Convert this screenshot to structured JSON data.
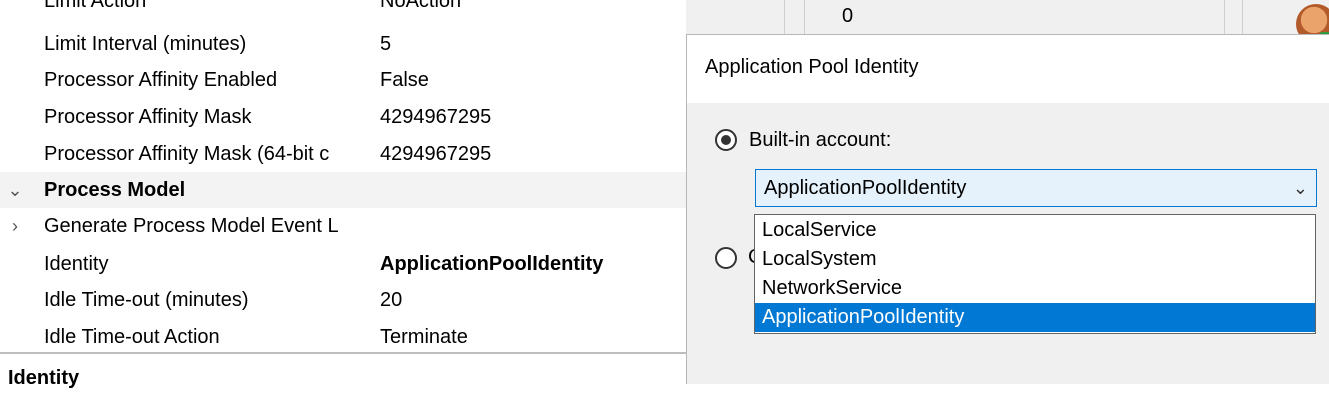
{
  "properties": {
    "rows": [
      {
        "name": "Limit Action",
        "value": "NoAction"
      },
      {
        "name": "Limit Interval (minutes)",
        "value": "5"
      },
      {
        "name": "Processor Affinity Enabled",
        "value": "False"
      },
      {
        "name": "Processor Affinity Mask",
        "value": "4294967295"
      },
      {
        "name": "Processor Affinity Mask (64-bit c",
        "value": "4294967295"
      },
      {
        "name": "Process Model",
        "value": ""
      },
      {
        "name": "Generate Process Model Event L",
        "value": ""
      },
      {
        "name": "Identity",
        "value": "ApplicationPoolIdentity"
      },
      {
        "name": "Idle Time-out (minutes)",
        "value": "20"
      },
      {
        "name": "Idle Time-out Action",
        "value": "Terminate"
      }
    ],
    "category_chevron": "chevron-down-icon",
    "child_chevron": "chevron-right-icon"
  },
  "description": {
    "title": "Identity"
  },
  "background": {
    "cell_value": "0"
  },
  "dialog": {
    "title": "Application Pool Identity",
    "builtin_label": "Built-in account:",
    "builtin_selected": true,
    "custom_peek": "C",
    "combo": {
      "value": "ApplicationPoolIdentity",
      "arrow_icon": "chevron-down-icon"
    },
    "options": [
      "LocalService",
      "LocalSystem",
      "NetworkService",
      "ApplicationPoolIdentity"
    ],
    "selected_option": "ApplicationPoolIdentity"
  },
  "colors": {
    "accent": "#0078d4",
    "combo_bg": "#e5f1fb",
    "dialog_bg": "#f0f0f0"
  }
}
